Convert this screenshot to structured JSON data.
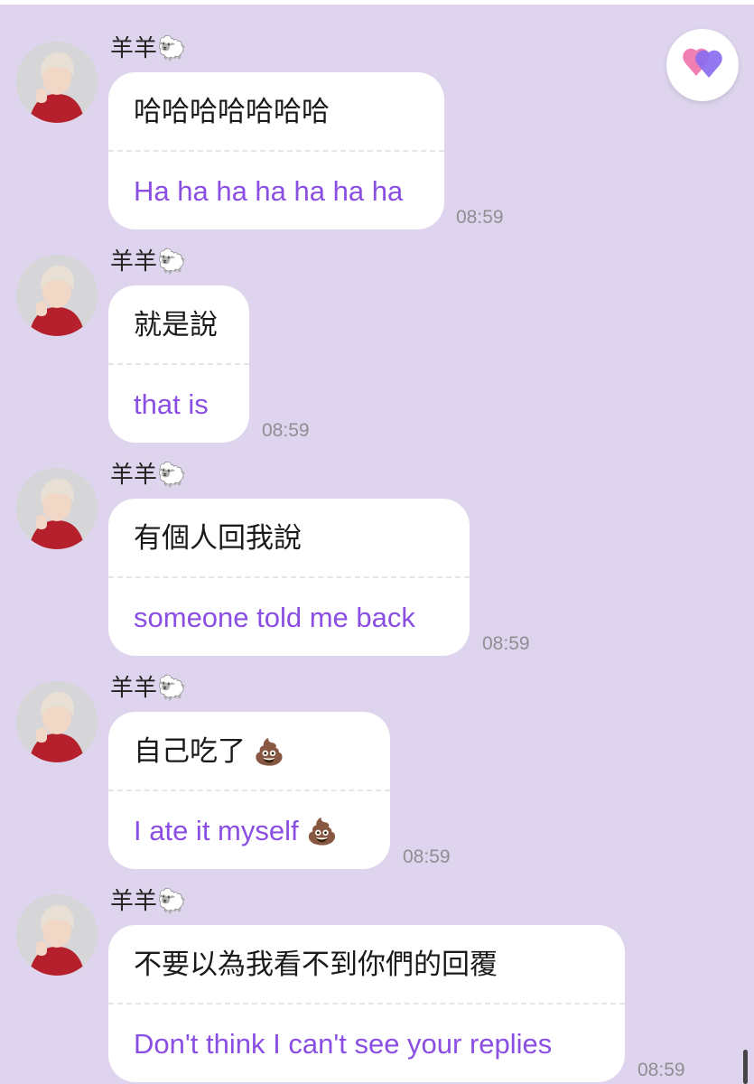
{
  "messages": [
    {
      "sender": "羊羊",
      "sender_emoji": "🐑",
      "original": "哈哈哈哈哈哈哈",
      "translation": "Ha ha ha ha ha ha ha",
      "time": "08:59"
    },
    {
      "sender": "羊羊",
      "sender_emoji": "🐑",
      "original": "就是說",
      "translation": "that is",
      "time": "08:59"
    },
    {
      "sender": "羊羊",
      "sender_emoji": "🐑",
      "original": "有個人回我說",
      "translation": "someone told me back",
      "time": "08:59"
    },
    {
      "sender": "羊羊",
      "sender_emoji": "🐑",
      "original": "自己吃了",
      "original_emoji": "💩",
      "translation": "I ate it myself",
      "translation_emoji": "💩",
      "time": "08:59"
    },
    {
      "sender": "羊羊",
      "sender_emoji": "🐑",
      "original": "不要以為我看不到你們的回覆",
      "translation": "Don't think I can't see your replies",
      "time": "08:59"
    }
  ],
  "floating_button": {
    "icon": "heart-icon",
    "colors": [
      "#f07fb3",
      "#8b6cf0"
    ]
  },
  "theme": {
    "background": "#ded4ee",
    "bubble": "#ffffff",
    "translation_color": "#8a4fe2",
    "time_color": "#8e8e93"
  }
}
